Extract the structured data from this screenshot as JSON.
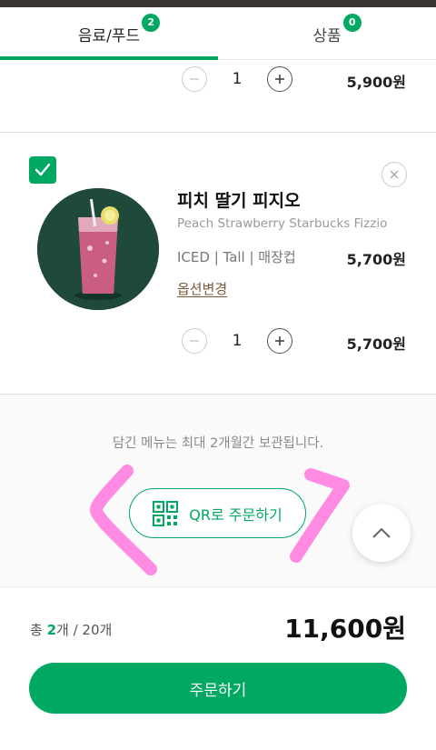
{
  "tabs": [
    {
      "label": "음료/푸드",
      "badge": "2",
      "active": true
    },
    {
      "label": "상품",
      "badge": "0",
      "active": false
    }
  ],
  "item1": {
    "qty": "1",
    "line_price": "5,900원"
  },
  "item2": {
    "name": "피치 딸기 피지오",
    "name_en": "Peach Strawberry Starbucks Fizzio",
    "option": "ICED | Tall | 매장컵",
    "option_price": "5,700원",
    "option_change": "옵션변경",
    "qty": "1",
    "line_price": "5,700원"
  },
  "notice": "담긴 메뉴는 최대 2개월간 보관됩니다.",
  "qr_button": {
    "label": "QR로 주문하기",
    "icon": "qr-code-icon"
  },
  "footer": {
    "count_prefix": "총 ",
    "count_value": "2",
    "count_suffix": "개 / 20개",
    "total": "11,600원",
    "order_label": "주문하기"
  },
  "colors": {
    "accent": "#00a862",
    "annotation": "#ff7ee0",
    "product_bg": "#1f4a3a",
    "brown_link": "#7a5a3a"
  }
}
